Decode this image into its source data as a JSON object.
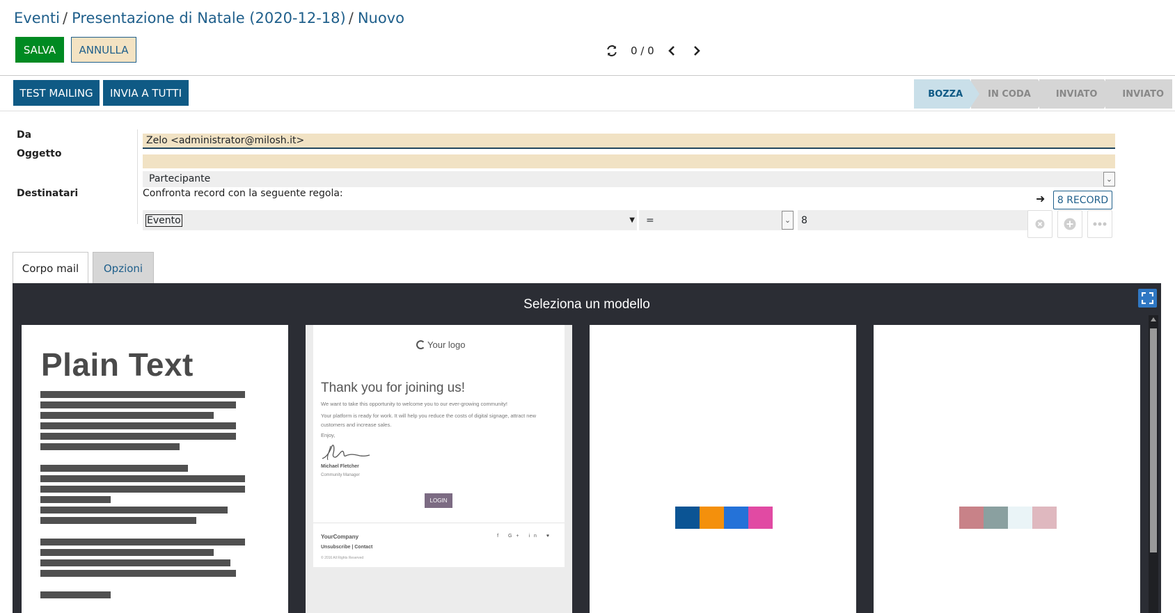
{
  "breadcrumb": {
    "items": [
      "Eventi",
      "Presentazione di Natale (2020-12-18)",
      "Nuovo"
    ],
    "separator": "/"
  },
  "actions": {
    "save": "SALVA",
    "cancel": "ANNULLA"
  },
  "pager": {
    "value": "0 / 0"
  },
  "mailing_buttons": {
    "test": "TEST MAILING",
    "send_all": "INVIA A TUTTI"
  },
  "status": {
    "steps": [
      "BOZZA",
      "IN CODA",
      "INVIATO",
      "INVIATO"
    ],
    "active": "BOZZA"
  },
  "form": {
    "from_label": "Da",
    "from_value": "Zelo <administrator@milosh.it>",
    "subject_label": "Oggetto",
    "subject_value": "",
    "recipients_label": "Destinatari",
    "recipient_model": "Partecipante",
    "rule_text": "Confronta record con la seguente regola:",
    "records_button": "8 RECORD",
    "rule": {
      "field": "Evento",
      "operator": "=",
      "value": "8"
    }
  },
  "tabs": {
    "body": "Corpo mail",
    "options": "Opzioni"
  },
  "template_selector": {
    "title": "Seleziona un modello",
    "plain_text_title": "Plain Text",
    "newsletter": {
      "logo": "Your logo",
      "heading": "Thank you for joining us!",
      "p1": "We want to take this opportunity to welcome you to our ever-growing community!",
      "p2": "Your platform is ready for work. It will help you reduce the costs of digital signage, attract new customers and increase sales.",
      "p3": "Enjoy,",
      "signature_name": "Michael Fletcher",
      "signature_role": "Community Manager",
      "login": "LOGIN",
      "company": "YourCompany",
      "links": "Unsubscribe | Contact",
      "copyright": "© 2016 All Rights Reserved",
      "social": "f G+ in ♥"
    },
    "palette1": [
      "#0b5494",
      "#f4900c",
      "#2472d8",
      "#e14aa3"
    ],
    "palette2": [
      "#c88288",
      "#8aa0a0",
      "#eaf4f7",
      "#dfb8bf"
    ]
  },
  "colors": {
    "primary": "#0f5a85",
    "save": "#008a22",
    "accent_link": "#1f5f8b",
    "required_field": "#f1e2c4"
  }
}
